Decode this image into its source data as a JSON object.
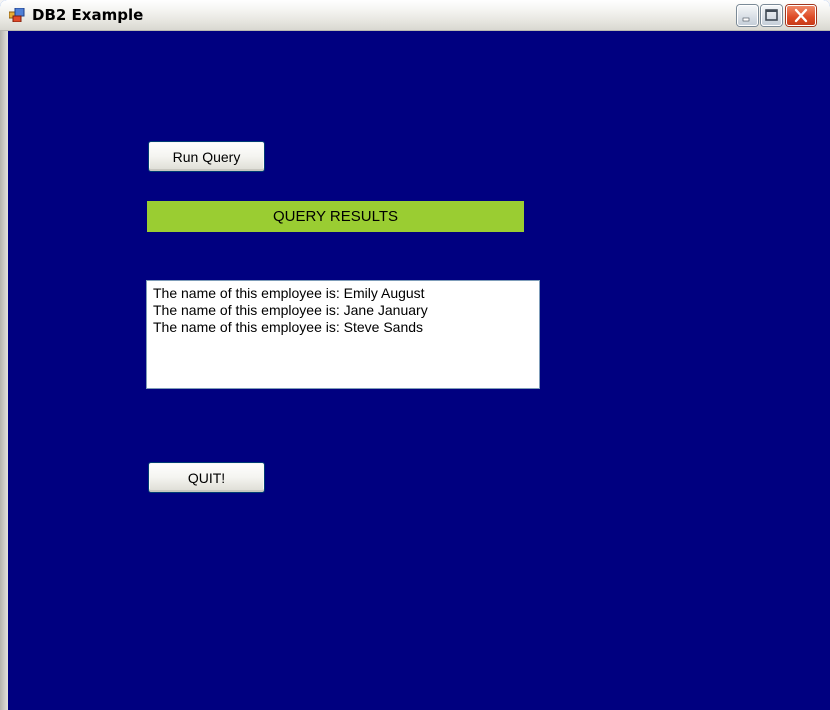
{
  "window": {
    "title": "DB2 Example",
    "icon": "application-window-icon",
    "controls": [
      "minimize-button",
      "maximize-button",
      "close-button"
    ]
  },
  "form": {
    "run_query_label": "Run Query",
    "results_header": "QUERY RESULTS",
    "results_lines": [
      "The name of this employee is: Emily August",
      "The name of this employee is: Jane January",
      "The name of this employee is: Steve Sands"
    ],
    "quit_label": "QUIT!"
  },
  "colors": {
    "form_background": "#000080",
    "results_header_background": "#9acd32",
    "close_button": "#dd4a26"
  }
}
